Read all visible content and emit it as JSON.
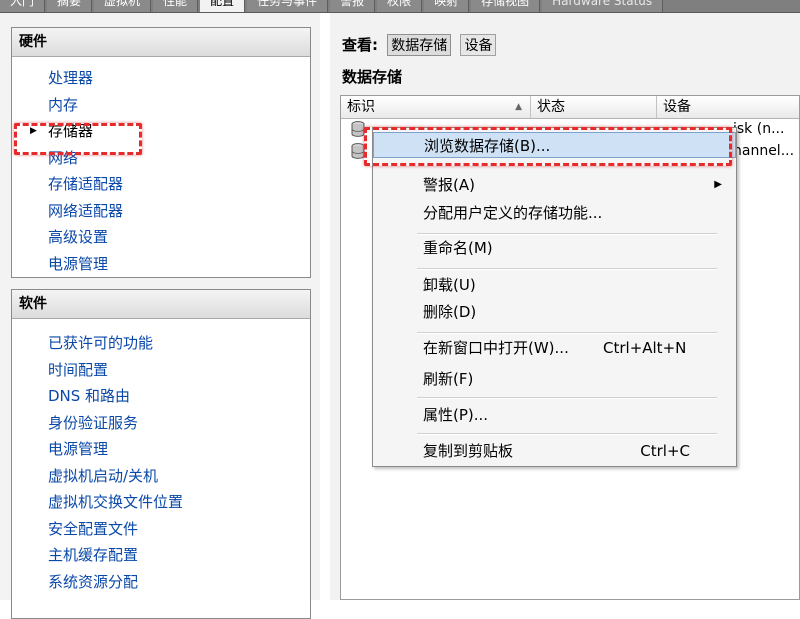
{
  "tabs": [
    {
      "label": "入门",
      "active": false
    },
    {
      "label": "摘要",
      "active": false
    },
    {
      "label": "虚拟机",
      "active": false
    },
    {
      "label": "性能",
      "active": false
    },
    {
      "label": "配置",
      "active": true
    },
    {
      "label": "任务与事件",
      "active": false
    },
    {
      "label": "警报",
      "active": false
    },
    {
      "label": "权限",
      "active": false
    },
    {
      "label": "映射",
      "active": false
    },
    {
      "label": "存储视图",
      "active": false
    },
    {
      "label": "Hardware Status",
      "active": false
    }
  ],
  "hardware": {
    "title": "硬件",
    "items": [
      "处理器",
      "内存",
      "存储器",
      "网络",
      "存储适配器",
      "网络适配器",
      "高级设置",
      "电源管理"
    ],
    "selected_index": 2
  },
  "software": {
    "title": "软件",
    "items": [
      "已获许可的功能",
      "时间配置",
      "DNS 和路由",
      "身份验证服务",
      "电源管理",
      "虚拟机启动/关机",
      "虚拟机交换文件位置",
      "安全配置文件",
      "主机缓存配置",
      "系统资源分配"
    ]
  },
  "view": {
    "label": "查看:",
    "buttons": [
      "数据存储",
      "设备"
    ],
    "active_index": 0
  },
  "pane_title": "数据存储",
  "table": {
    "columns": [
      "标识",
      "状态",
      "设备"
    ],
    "rows": [
      {
        "device": "isk (n..."
      },
      {
        "device": "hannel..."
      }
    ]
  },
  "context_menu": {
    "items": [
      {
        "label": "浏览数据存储(B)...",
        "shortcut": "",
        "submenu": false
      },
      {
        "label": "警报(A)",
        "shortcut": "",
        "submenu": true
      },
      {
        "label": "分配用户定义的存储功能...",
        "shortcut": "",
        "submenu": false
      },
      {
        "label": "重命名(M)",
        "shortcut": "",
        "submenu": false
      },
      {
        "label": "卸载(U)",
        "shortcut": "",
        "submenu": false
      },
      {
        "label": "删除(D)",
        "shortcut": "",
        "submenu": false
      },
      {
        "label": "在新窗口中打开(W)...",
        "shortcut": "Ctrl+Alt+N",
        "submenu": false
      },
      {
        "label": "刷新(F)",
        "shortcut": "",
        "submenu": false
      },
      {
        "label": "属性(P)...",
        "shortcut": "",
        "submenu": false
      },
      {
        "label": "复制到剪贴板",
        "shortcut": "Ctrl+C",
        "submenu": false
      }
    ]
  },
  "colors": {
    "link": "#0a48a8",
    "highlight_dash": "#e52b2b",
    "menu_hover": "#cfe2f5"
  }
}
